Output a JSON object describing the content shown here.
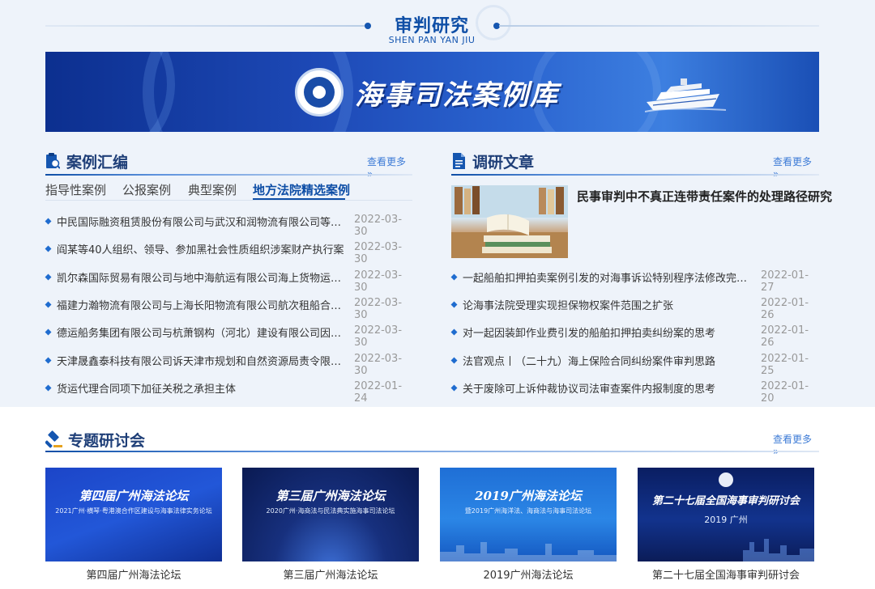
{
  "section": {
    "title": "审判研究",
    "subtitle": "SHEN PAN YAN JIU"
  },
  "banner": {
    "title": "海事司法案例库"
  },
  "cases": {
    "title": "案例汇编",
    "more": "查看更多 »",
    "tabs": [
      "指导性案例",
      "公报案例",
      "典型案例",
      "地方法院精选案例"
    ],
    "active_tab": 3,
    "items": [
      {
        "text": "中民国际融资租赁股份有限公司与武汉和润物流有限公司等七...",
        "date": "2022-03-30"
      },
      {
        "text": "阎某等40人组织、领导、参加黑社会性质组织涉案财产执行案",
        "date": "2022-03-30"
      },
      {
        "text": "凯尔森国际贸易有限公司与地中海航运有限公司海上货物运输...",
        "date": "2022-03-30"
      },
      {
        "text": "福建力瀚物流有限公司与上海长阳物流有限公司航次租船合同...",
        "date": "2022-03-30"
      },
      {
        "text": "德运船务集团有限公司与杭萧钢构（河北）建设有限公司因保...",
        "date": "2022-03-30"
      },
      {
        "text": "天津晟鑫泰科技有限公司诉天津市规划和自然资源局责令限期...",
        "date": "2022-03-30"
      },
      {
        "text": "货运代理合同项下加征关税之承担主体",
        "date": "2022-01-24"
      }
    ]
  },
  "research": {
    "title": "调研文章",
    "more": "查看更多 »",
    "feature_title": "民事审判中不真正连带责任案件的处理路径研究",
    "items": [
      {
        "text": "一起船舶扣押拍卖案例引发的对海事诉讼特别程序法修改完善...",
        "date": "2022-01-27"
      },
      {
        "text": "论海事法院受理实现担保物权案件范围之扩张",
        "date": "2022-01-26"
      },
      {
        "text": "对一起因装卸作业费引发的船舶扣押拍卖纠纷案的思考",
        "date": "2022-01-26"
      },
      {
        "text": "法官观点丨（二十九）海上保险合同纠纷案件审判思路",
        "date": "2022-01-25"
      },
      {
        "text": "关于废除可上诉仲裁协议司法审查案件内报制度的思考",
        "date": "2022-01-20"
      }
    ]
  },
  "seminars": {
    "title": "专题研讨会",
    "more": "查看更多 »",
    "cards": [
      {
        "thumb_title": "第四届广州海法论坛",
        "thumb_sub": "2021广州·横琴·粤港澳合作区建设与海事法律实务论坛",
        "caption": "第四届广州海法论坛"
      },
      {
        "thumb_title": "第三届广州海法论坛",
        "thumb_sub": "2020广州·海商法与民法典实施海事司法论坛",
        "caption": "第三届广州海法论坛"
      },
      {
        "thumb_title": "2019广州海法论坛",
        "thumb_sub": "暨2019广州海洋法、海商法与海事司法论坛",
        "caption": "2019广州海法论坛"
      },
      {
        "thumb_title": "第二十七届全国海事审判研讨会",
        "thumb_sub": "2019 广州",
        "caption": "第二十七届全国海事审判研讨会"
      }
    ]
  }
}
